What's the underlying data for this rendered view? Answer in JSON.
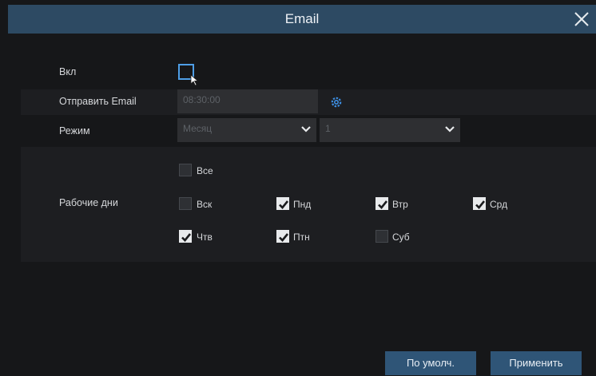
{
  "dialog": {
    "title": "Email"
  },
  "form": {
    "enable_label": "Вкл",
    "send_email_label": "Отправить Email",
    "send_time_value": "08:30:00",
    "mode_label": "Режим",
    "mode_value": "Месяц",
    "mode_sub_value": "1",
    "workdays_label": "Рабочие дни"
  },
  "days": {
    "all": {
      "label": "Все",
      "checked": false
    },
    "sun": {
      "label": "Вск",
      "checked": false
    },
    "mon": {
      "label": "Пнд",
      "checked": true
    },
    "tue": {
      "label": "Втр",
      "checked": true
    },
    "wed": {
      "label": "Срд",
      "checked": true
    },
    "thu": {
      "label": "Чтв",
      "checked": true
    },
    "fri": {
      "label": "Птн",
      "checked": true
    },
    "sat": {
      "label": "Суб",
      "checked": false
    }
  },
  "buttons": {
    "default_label": "По умолч.",
    "apply_label": "Применить"
  },
  "colors": {
    "accent": "#4e9ee6",
    "titlebar": "#2d4a63",
    "button": "#2f5577"
  }
}
